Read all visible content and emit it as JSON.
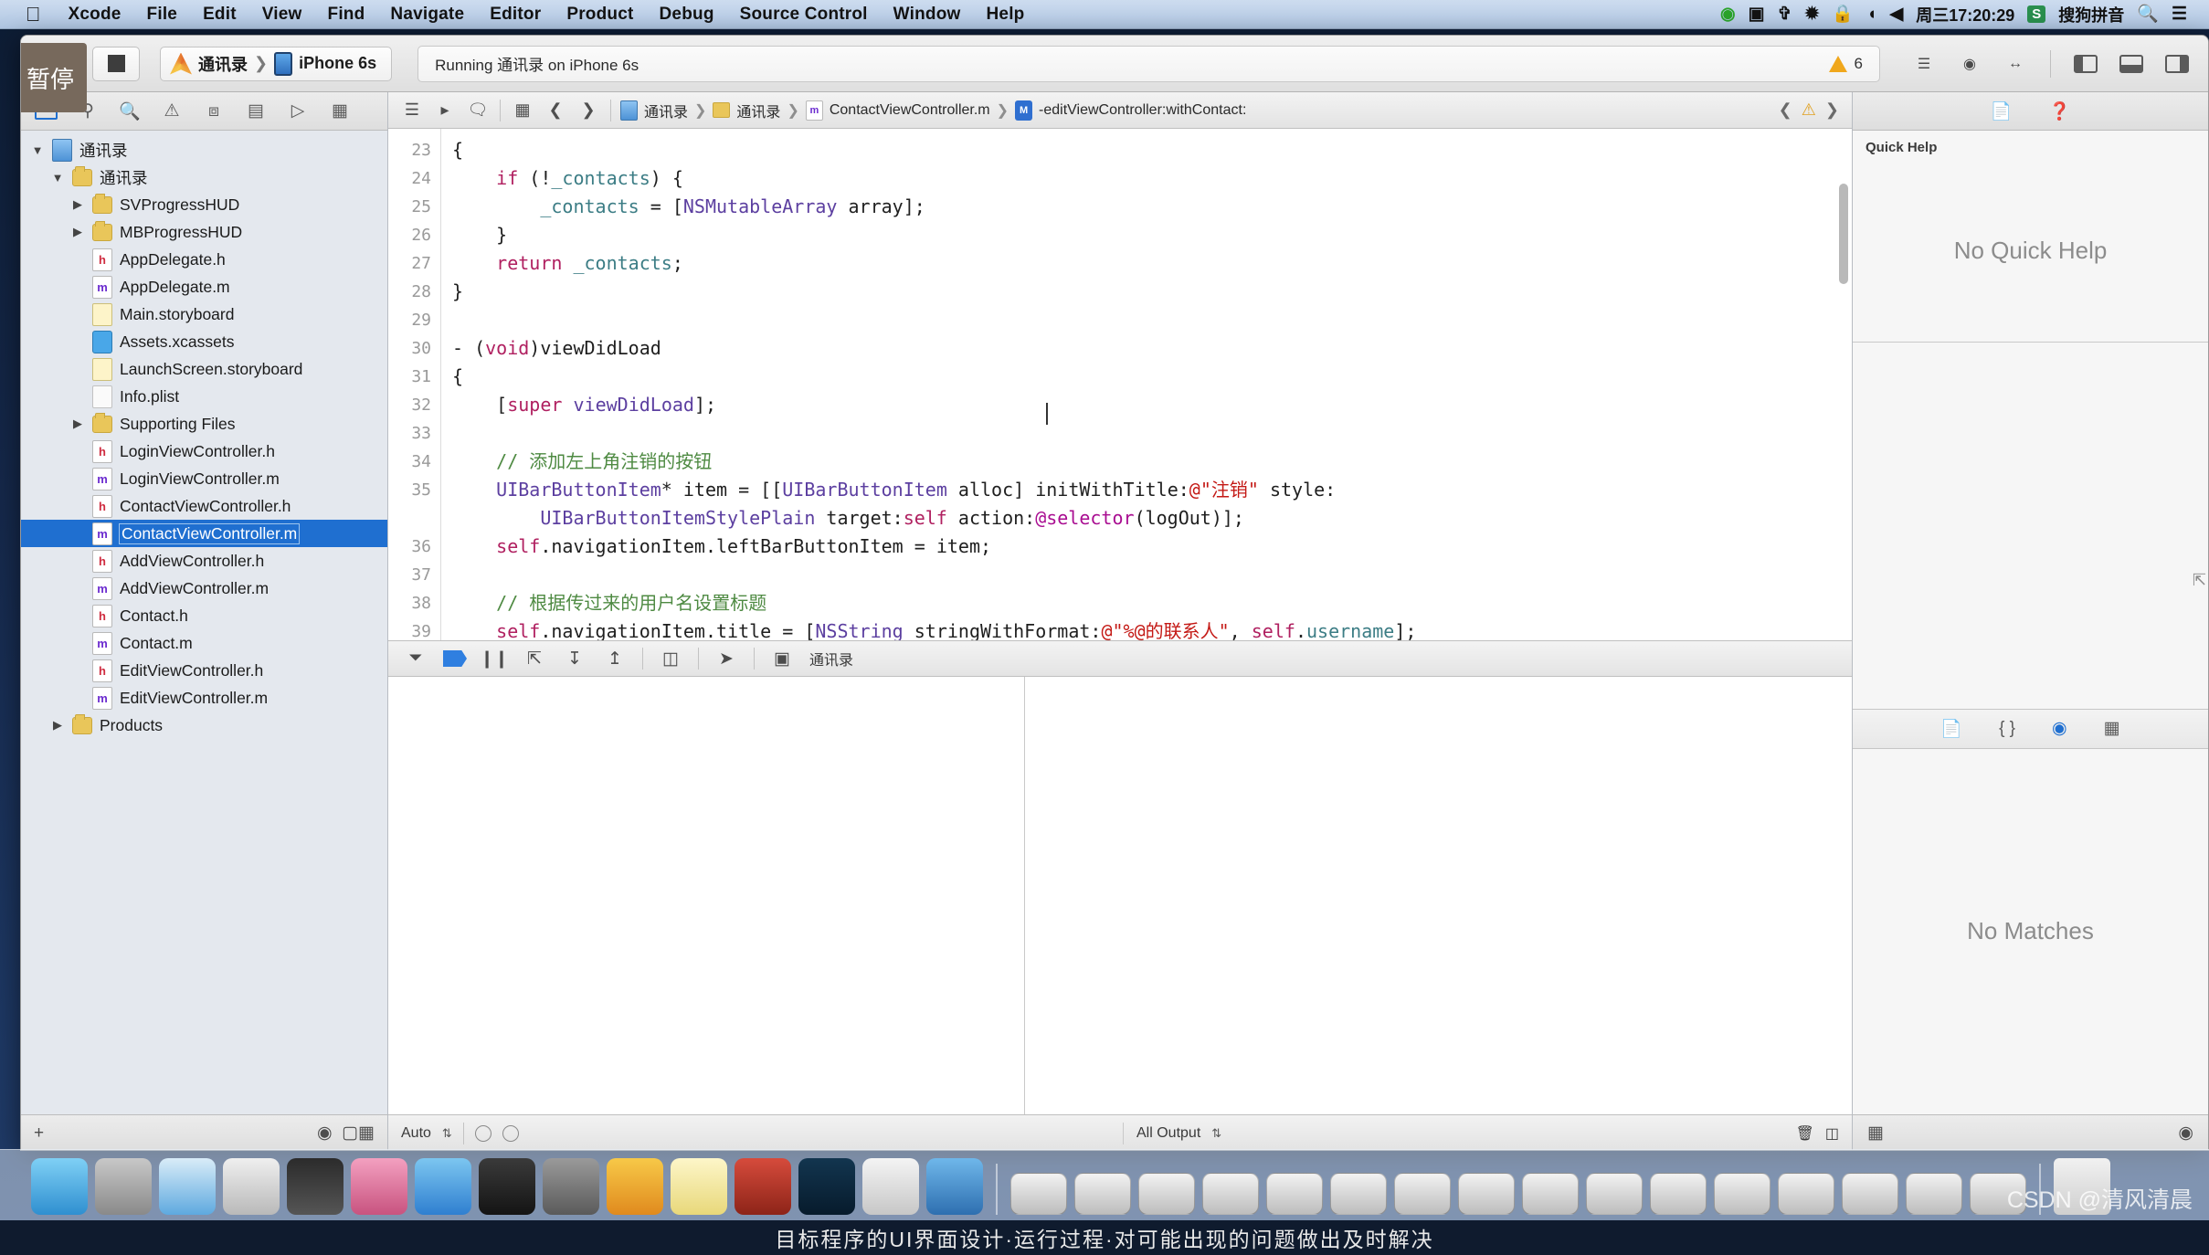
{
  "menubar": {
    "apple": "apple-logo",
    "items": [
      "Xcode",
      "File",
      "Edit",
      "View",
      "Find",
      "Navigate",
      "Editor",
      "Product",
      "Debug",
      "Source Control",
      "Window",
      "Help"
    ],
    "right": {
      "clock": "周三17:20:29",
      "input_method": "搜狗拼音",
      "sogou_mark": "S",
      "icons": [
        "flash-icon",
        "screen-record-icon",
        "airplay-icon",
        "bluetooth-icon",
        "lock-icon",
        "wifi-icon",
        "volume-icon",
        "spotlight-search-icon",
        "notification-center-icon"
      ]
    }
  },
  "toolbar": {
    "tooltip": "暂停",
    "run_label": "run-button",
    "stop_label": "stop-button",
    "scheme": "通讯录",
    "destination": "iPhone 6s",
    "status": "Running 通讯录 on iPhone 6s",
    "warning_count": "6",
    "editor_modes": [
      "standard-editor",
      "assistant-editor",
      "version-editor"
    ],
    "panel_toggles": [
      "navigator-toggle",
      "debug-area-toggle",
      "utilities-toggle"
    ]
  },
  "navigator": {
    "tabs": [
      "project-navigator",
      "symbol-navigator",
      "find-navigator",
      "issue-navigator",
      "test-navigator",
      "debug-navigator",
      "breakpoint-navigator",
      "report-navigator"
    ],
    "tree": [
      {
        "depth": 0,
        "tw": "▼",
        "icon": "proj",
        "label": "通讯录"
      },
      {
        "depth": 1,
        "tw": "▼",
        "icon": "folder",
        "label": "通讯录"
      },
      {
        "depth": 2,
        "tw": "▶",
        "icon": "folder",
        "label": "SVProgressHUD"
      },
      {
        "depth": 2,
        "tw": "▶",
        "icon": "folder",
        "label": "MBProgressHUD"
      },
      {
        "depth": 2,
        "tw": "",
        "icon": "h",
        "label": "AppDelegate.h"
      },
      {
        "depth": 2,
        "tw": "",
        "icon": "m",
        "label": "AppDelegate.m"
      },
      {
        "depth": 2,
        "tw": "",
        "icon": "sb",
        "label": "Main.storyboard"
      },
      {
        "depth": 2,
        "tw": "",
        "icon": "assets",
        "label": "Assets.xcassets"
      },
      {
        "depth": 2,
        "tw": "",
        "icon": "sb",
        "label": "LaunchScreen.storyboard"
      },
      {
        "depth": 2,
        "tw": "",
        "icon": "plist",
        "label": "Info.plist"
      },
      {
        "depth": 2,
        "tw": "▶",
        "icon": "folder",
        "label": "Supporting Files"
      },
      {
        "depth": 2,
        "tw": "",
        "icon": "h",
        "label": "LoginViewController.h"
      },
      {
        "depth": 2,
        "tw": "",
        "icon": "m",
        "label": "LoginViewController.m"
      },
      {
        "depth": 2,
        "tw": "",
        "icon": "h",
        "label": "ContactViewController.h"
      },
      {
        "depth": 2,
        "tw": "",
        "icon": "m",
        "label": "ContactViewController.m",
        "selected": true
      },
      {
        "depth": 2,
        "tw": "",
        "icon": "h",
        "label": "AddViewController.h"
      },
      {
        "depth": 2,
        "tw": "",
        "icon": "m",
        "label": "AddViewController.m"
      },
      {
        "depth": 2,
        "tw": "",
        "icon": "h",
        "label": "Contact.h"
      },
      {
        "depth": 2,
        "tw": "",
        "icon": "m",
        "label": "Contact.m"
      },
      {
        "depth": 2,
        "tw": "",
        "icon": "h",
        "label": "EditViewController.h"
      },
      {
        "depth": 2,
        "tw": "",
        "icon": "m",
        "label": "EditViewController.m"
      },
      {
        "depth": 1,
        "tw": "▶",
        "icon": "folder",
        "label": "Products"
      }
    ],
    "footer": {
      "add": "+",
      "filter": "filter-icon",
      "options": "options-icon"
    }
  },
  "jumpbar": {
    "icons": [
      "related-items-icon",
      "previous-file-icon",
      "next-file-icon"
    ],
    "crumbs": [
      {
        "icon": "proj",
        "label": "通讯录"
      },
      {
        "icon": "folder",
        "label": "通讯录"
      },
      {
        "icon": "m",
        "label": "ContactViewController.m"
      },
      {
        "icon": "method",
        "label": "-editViewController:withContact:",
        "badge": "M"
      }
    ],
    "right_icons": [
      "previous-issue-icon",
      "warning-icon",
      "next-issue-icon"
    ]
  },
  "editor": {
    "first_line": 23,
    "lines": [
      {
        "n": "23",
        "tokens": [
          {
            "t": "{",
            "c": "plain"
          }
        ]
      },
      {
        "n": "24",
        "tokens": [
          {
            "t": "    ",
            "c": "plain"
          },
          {
            "t": "if",
            "c": "kw2"
          },
          {
            "t": " (!",
            "c": "plain"
          },
          {
            "t": "_contacts",
            "c": "var"
          },
          {
            "t": ") {",
            "c": "plain"
          }
        ]
      },
      {
        "n": "25",
        "tokens": [
          {
            "t": "        ",
            "c": "plain"
          },
          {
            "t": "_contacts",
            "c": "var"
          },
          {
            "t": " = [",
            "c": "plain"
          },
          {
            "t": "NSMutableArray",
            "c": "cls"
          },
          {
            "t": " array];",
            "c": "plain"
          }
        ]
      },
      {
        "n": "26",
        "tokens": [
          {
            "t": "    }",
            "c": "plain"
          }
        ]
      },
      {
        "n": "27",
        "tokens": [
          {
            "t": "    ",
            "c": "plain"
          },
          {
            "t": "return",
            "c": "kw2"
          },
          {
            "t": " ",
            "c": "plain"
          },
          {
            "t": "_contacts",
            "c": "var"
          },
          {
            "t": ";",
            "c": "plain"
          }
        ]
      },
      {
        "n": "28",
        "tokens": [
          {
            "t": "}",
            "c": "plain"
          }
        ]
      },
      {
        "n": "29",
        "tokens": [
          {
            "t": "",
            "c": "plain"
          }
        ]
      },
      {
        "n": "30",
        "tokens": [
          {
            "t": "- (",
            "c": "plain"
          },
          {
            "t": "void",
            "c": "kw2"
          },
          {
            "t": ")viewDidLoad",
            "c": "plain"
          }
        ]
      },
      {
        "n": "31",
        "tokens": [
          {
            "t": "{",
            "c": "plain"
          }
        ]
      },
      {
        "n": "32",
        "tokens": [
          {
            "t": "    [",
            "c": "plain"
          },
          {
            "t": "super",
            "c": "kw2"
          },
          {
            "t": " ",
            "c": "plain"
          },
          {
            "t": "viewDidLoad",
            "c": "cls"
          },
          {
            "t": "];",
            "c": "plain"
          }
        ]
      },
      {
        "n": "33",
        "tokens": [
          {
            "t": "",
            "c": "plain"
          }
        ]
      },
      {
        "n": "34",
        "tokens": [
          {
            "t": "    ",
            "c": "plain"
          },
          {
            "t": "// 添加左上角注销的按钮",
            "c": "cmt"
          }
        ]
      },
      {
        "n": "35",
        "tokens": [
          {
            "t": "    ",
            "c": "plain"
          },
          {
            "t": "UIBarButtonItem",
            "c": "cls"
          },
          {
            "t": "* item = [[",
            "c": "plain"
          },
          {
            "t": "UIBarButtonItem",
            "c": "cls"
          },
          {
            "t": " alloc] initWithTitle:",
            "c": "plain"
          },
          {
            "t": "@\"注销\"",
            "c": "str"
          },
          {
            "t": " style:",
            "c": "plain"
          }
        ]
      },
      {
        "n": "",
        "tokens": [
          {
            "t": "        ",
            "c": "plain"
          },
          {
            "t": "UIBarButtonItemStylePlain",
            "c": "cls"
          },
          {
            "t": " target:",
            "c": "plain"
          },
          {
            "t": "self",
            "c": "kw2"
          },
          {
            "t": " action:",
            "c": "plain"
          },
          {
            "t": "@selector",
            "c": "kw"
          },
          {
            "t": "(logOut)];",
            "c": "plain"
          }
        ]
      },
      {
        "n": "36",
        "tokens": [
          {
            "t": "    ",
            "c": "plain"
          },
          {
            "t": "self",
            "c": "kw2"
          },
          {
            "t": ".navigationItem.leftBarButtonItem = item;",
            "c": "plain"
          }
        ]
      },
      {
        "n": "37",
        "tokens": [
          {
            "t": "",
            "c": "plain"
          }
        ]
      },
      {
        "n": "38",
        "tokens": [
          {
            "t": "    ",
            "c": "plain"
          },
          {
            "t": "// 根据传过来的用户名设置标题",
            "c": "cmt"
          }
        ]
      },
      {
        "n": "39",
        "tokens": [
          {
            "t": "    ",
            "c": "plain"
          },
          {
            "t": "self",
            "c": "kw2"
          },
          {
            "t": ".navigationItem.title = [",
            "c": "plain"
          },
          {
            "t": "NSString",
            "c": "cls"
          },
          {
            "t": " stringWithFormat:",
            "c": "plain"
          },
          {
            "t": "@\"%@的联系人\"",
            "c": "str"
          },
          {
            "t": ", ",
            "c": "plain"
          },
          {
            "t": "self",
            "c": "kw2"
          },
          {
            "t": ".",
            "c": "plain"
          },
          {
            "t": "username",
            "c": "var"
          },
          {
            "t": "];",
            "c": "plain"
          }
        ]
      }
    ]
  },
  "debugbar": {
    "icons": [
      "hide-debug-area-icon",
      "breakpoint-toggle-icon",
      "continue-icon",
      "step-over-icon",
      "step-into-icon",
      "step-out-icon",
      "view-debug-icon",
      "location-simulate-icon"
    ],
    "process_label": "通讯录"
  },
  "debugfooter": {
    "scope": "Auto",
    "scope_stepper": "⇅",
    "output_filter": "All Output",
    "output_stepper": "⇅",
    "filter_placeholder": "",
    "icons": [
      "scope-eye-icon",
      "info-icon",
      "trash-icon",
      "split-panel-icon"
    ]
  },
  "utilities": {
    "tabs": [
      "file-inspector",
      "quick-help-inspector"
    ],
    "quick_help_title": "Quick Help",
    "quick_help_body": "No Quick Help",
    "library_tabs": [
      "file-template-library",
      "code-snippet-library",
      "object-library",
      "media-library"
    ],
    "library_body": "No Matches",
    "footer": {
      "grid": "grid-icon",
      "filter": "filter-icon"
    }
  },
  "dock": {
    "items": [
      "finder",
      "launchpad",
      "safari",
      "mission-control",
      "photos",
      "itunes",
      "app-store",
      "terminal",
      "system-preferences",
      "sketch",
      "notes",
      "dictionary",
      "photoshop",
      "preview",
      "xcode"
    ]
  },
  "watermark": "CSDN @清风清晨",
  "bottom_caption": "目标程序的UI界面设计·运行过程·对可能出现的问题做出及时解决",
  "colors": {
    "accent": "#1f6fd0",
    "warning": "#f0a71c",
    "selection": "#1f6fd0",
    "comment": "#4e8a42",
    "string": "#c41a16",
    "keyword": "#b02060",
    "class": "#5c3fa0"
  }
}
